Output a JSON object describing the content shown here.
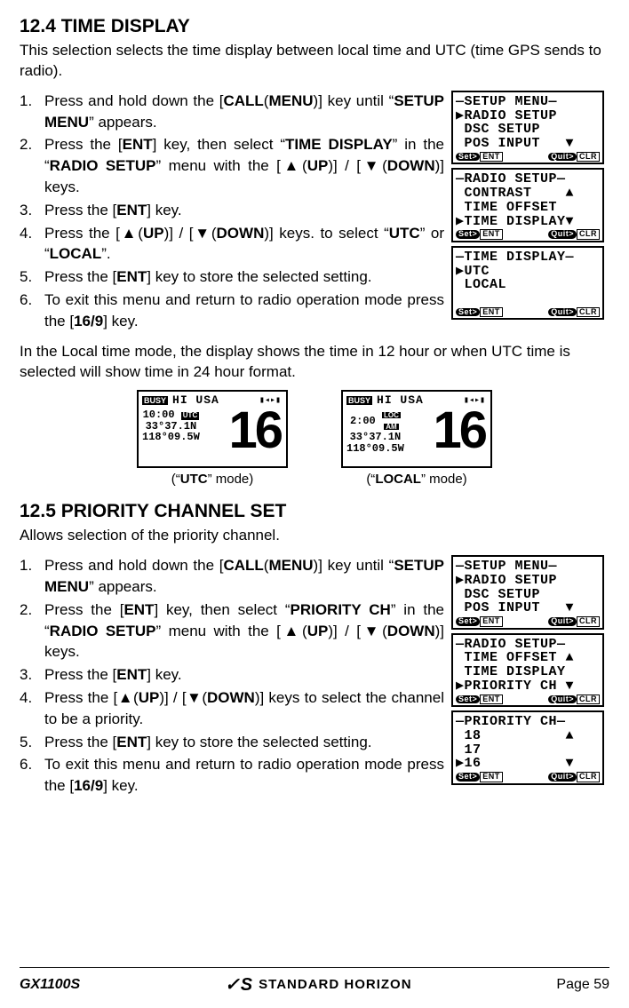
{
  "section1": {
    "title": "12.4  TIME DISPLAY",
    "intro": "This selection selects the time display between local time and UTC (time GPS sends to radio).",
    "steps": [
      "Press and hold down the [<b>CALL</b>(<b>MENU</b>)] key until “<b>SETUP MENU</b>” appears.",
      "Press the [<b>ENT</b>] key, then select “<b>TIME DISPLAY</b>” in the “<b>RADIO SETUP</b>” menu with the [▲(<b>UP</b>)] / [▼(<b>DOWN</b>)] keys.",
      "Press the [<b>ENT</b>] key.",
      "Press the [▲(<b>UP</b>)] / [▼(<b>DOWN</b>)] keys. to select “<b>UTC</b>” or “<b>LOCAL</b>”.",
      "Press the [<b>ENT</b>] key to store  the selected setting.",
      "To exit this menu and return to radio operation mode press the [<b>16/9</b>] key."
    ],
    "after": "In the Local time mode, the display shows the time in 12 hour or when UTC time is selected will show time in 24 hour format.",
    "screens": [
      {
        "title": "—SETUP MENU—",
        "lines": [
          "▶RADIO SETUP",
          " DSC SETUP",
          " POS INPUT   ▼"
        ]
      },
      {
        "title": "—RADIO SETUP—",
        "lines": [
          " CONTRAST    ▲",
          " TIME OFFSET",
          "▶TIME DISPLAY▼"
        ]
      },
      {
        "title": "—TIME DISPLAY—",
        "lines": [
          "▶UTC",
          " LOCAL",
          " "
        ]
      }
    ],
    "foot_set": "Set>",
    "foot_ent": "ENT",
    "foot_quit": "Quit>",
    "foot_clr": "CLR",
    "ch_displays": {
      "utc": {
        "busy": "BUSY",
        "hi": "HI USA",
        "time": "10:00",
        "tz": "UTC",
        "lat": " 33°37.1N",
        "lon": "118°09.5W",
        "big": "16",
        "caption": "(“UTC” mode)"
      },
      "local": {
        "busy": "BUSY",
        "hi": "HI USA",
        "time": " 2:00",
        "tz1": "LOC",
        "tz2": "AM",
        "lat": " 33°37.1N",
        "lon": "118°09.5W",
        "big": "16",
        "caption": "(“LOCAL” mode)"
      }
    }
  },
  "section2": {
    "title": "12.5  PRIORITY CHANNEL SET",
    "intro": "Allows selection of the priority channel.",
    "steps": [
      "Press and hold down the [<b>CALL</b>(<b>MENU</b>)] key until “<b>SETUP MENU</b>” appears.",
      "Press the [<b>ENT</b>] key, then select “<b>PRIORITY CH</b>” in the “<b>RADIO SETUP</b>” menu with the [▲(<b>UP</b>)] / [▼(<b>DOWN</b>)] keys.",
      "Press the [<b>ENT</b>] key.",
      "Press the [▲(<b>UP</b>)] / [▼(<b>DOWN</b>)] keys to select the channel to be a priority.",
      "Press the [<b>ENT</b>] key to  store the selected setting.",
      "To exit this menu and return to radio operation mode press the [<b>16/9</b>] key."
    ],
    "screens": [
      {
        "title": "—SETUP MENU—",
        "lines": [
          "▶RADIO SETUP",
          " DSC SETUP",
          " POS INPUT   ▼"
        ]
      },
      {
        "title": "—RADIO SETUP—",
        "lines": [
          " TIME OFFSET ▲",
          " TIME DISPLAY",
          "▶PRIORITY CH ▼"
        ]
      },
      {
        "title": "—PRIORITY CH—",
        "lines": [
          " 18          ▲",
          " 17",
          "▶16          ▼"
        ]
      }
    ]
  },
  "footer": {
    "model": "GX1100S",
    "brand": "STANDARD HORIZON",
    "page": "Page 59"
  }
}
